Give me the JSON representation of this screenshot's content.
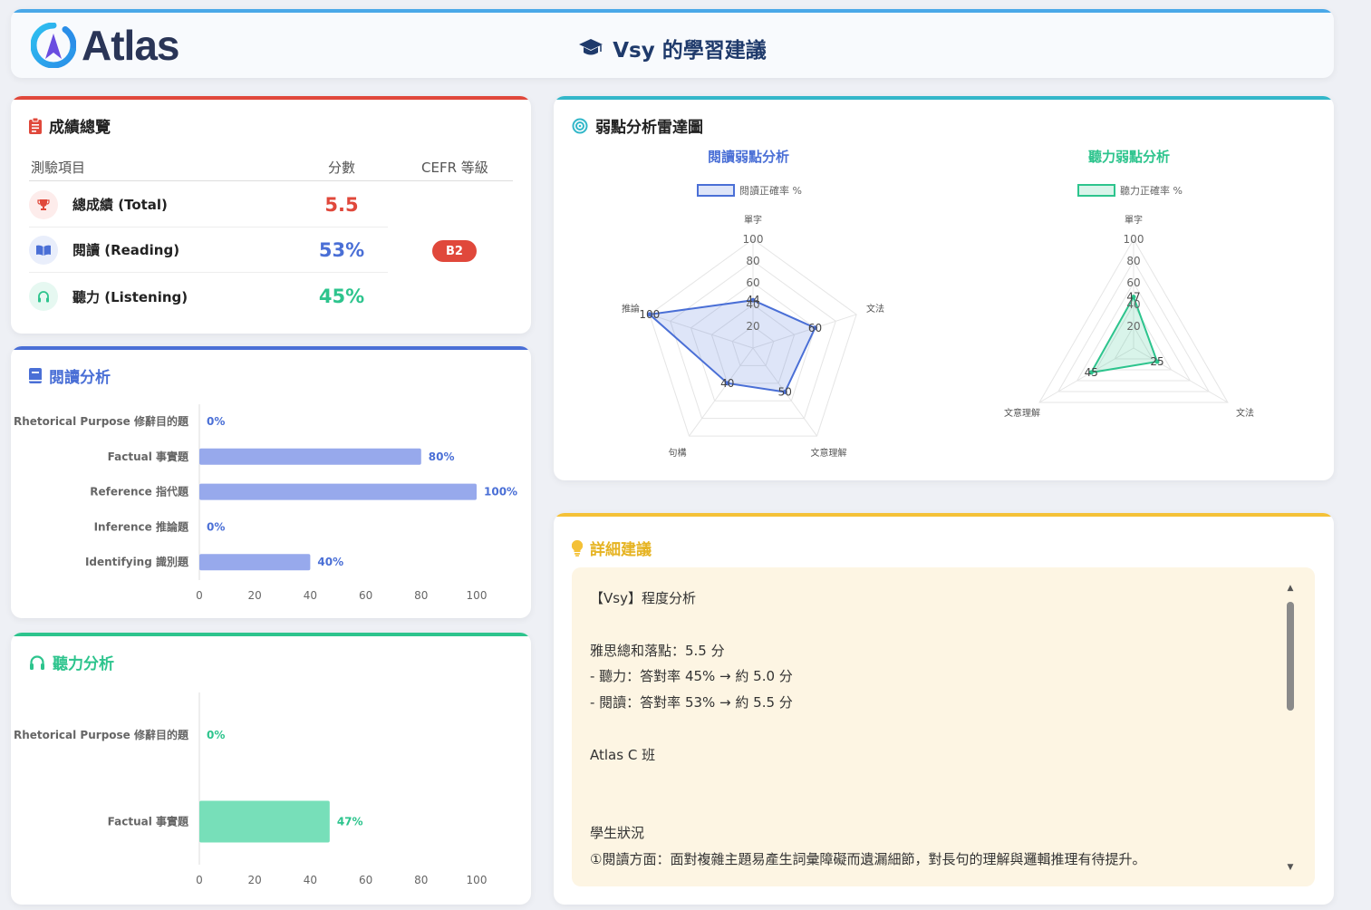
{
  "header": {
    "logo_text": "Atlas",
    "title": "Vsy 的學習建議",
    "title_icon": "graduation-cap-icon"
  },
  "score_overview": {
    "title": "成績總覽",
    "icon": "clipboard-icon",
    "col_item": "測驗項目",
    "col_score": "分數",
    "col_cefr": "CEFR 等級",
    "rows": [
      {
        "label": "總成績 (Total)",
        "value": "5.5",
        "icon": "trophy-icon",
        "color": "#e0483b",
        "bg": "#fdeceb"
      },
      {
        "label": "閱讀 (Reading)",
        "value": "53%",
        "icon": "book-open-icon",
        "color": "#4a6fd6",
        "bg": "#e9eefb"
      },
      {
        "label": "聽力 (Listening)",
        "value": "45%",
        "icon": "headphones-icon",
        "color": "#2dc48d",
        "bg": "#e6f8f1"
      }
    ],
    "cefr": "B2"
  },
  "reading_analysis": {
    "title": "閱讀分析",
    "icon": "book-icon",
    "color": "#4a6fd6"
  },
  "listening_analysis": {
    "title": "聽力分析",
    "icon": "headphones-icon",
    "color": "#2dc48d"
  },
  "radar_section": {
    "title": "弱點分析雷達圖",
    "icon": "target-icon"
  },
  "advice": {
    "title": "詳細建議",
    "icon": "lightbulb-icon",
    "lines": [
      "【Vsy】程度分析",
      "",
      "雅思總和落點：5.5 分",
      "- 聽力：答對率 45% → 約 5.0 分",
      "- 閱讀：答對率 53% → 約 5.5 分",
      "",
      "Atlas C 班",
      "",
      "",
      "學生狀況",
      "①閱讀方面：面對複雜主題易產生詞彙障礙而遺漏細節，對長句的理解與邏輯推理有待提升。"
    ]
  },
  "chart_data": [
    {
      "type": "bar",
      "orientation": "horizontal",
      "categories": [
        "Rhetorical Purpose 修辭目的題",
        "Factual 事實題",
        "Reference 指代題",
        "Inference 推論題",
        "Identifying 識別題"
      ],
      "values": [
        0,
        80,
        100,
        0,
        40
      ],
      "value_labels": [
        "0%",
        "80%",
        "100%",
        "0%",
        "40%"
      ],
      "xlim": [
        0,
        100
      ],
      "xticks": [
        0,
        20,
        40,
        60,
        80,
        100
      ],
      "bar_color": "#97a9ec",
      "label_color": "#4a6fd6"
    },
    {
      "type": "bar",
      "orientation": "horizontal",
      "categories": [
        "Rhetorical Purpose 修辭目的題",
        "Factual 事實題"
      ],
      "values": [
        0,
        47
      ],
      "value_labels": [
        "0%",
        "47%"
      ],
      "xlim": [
        0,
        100
      ],
      "xticks": [
        0,
        20,
        40,
        60,
        80,
        100
      ],
      "bar_color": "#77dfb9",
      "label_color": "#2dc48d"
    },
    {
      "type": "radar",
      "title": "閱讀弱點分析",
      "legend": "閱讀正確率 %",
      "axes": [
        "單字",
        "文法",
        "文意理解",
        "句構",
        "推論"
      ],
      "values": [
        44,
        60,
        50,
        40,
        100
      ],
      "rlim": [
        0,
        100
      ],
      "rticks": [
        20,
        40,
        60,
        80,
        100
      ],
      "color": "#4a6fd6"
    },
    {
      "type": "radar",
      "title": "聽力弱點分析",
      "legend": "聽力正確率 %",
      "axes": [
        "單字",
        "文法",
        "文意理解"
      ],
      "values": [
        47,
        25,
        45
      ],
      "rlim": [
        0,
        100
      ],
      "rticks": [
        20,
        40,
        60,
        80,
        100
      ],
      "color": "#2dc48d"
    }
  ]
}
